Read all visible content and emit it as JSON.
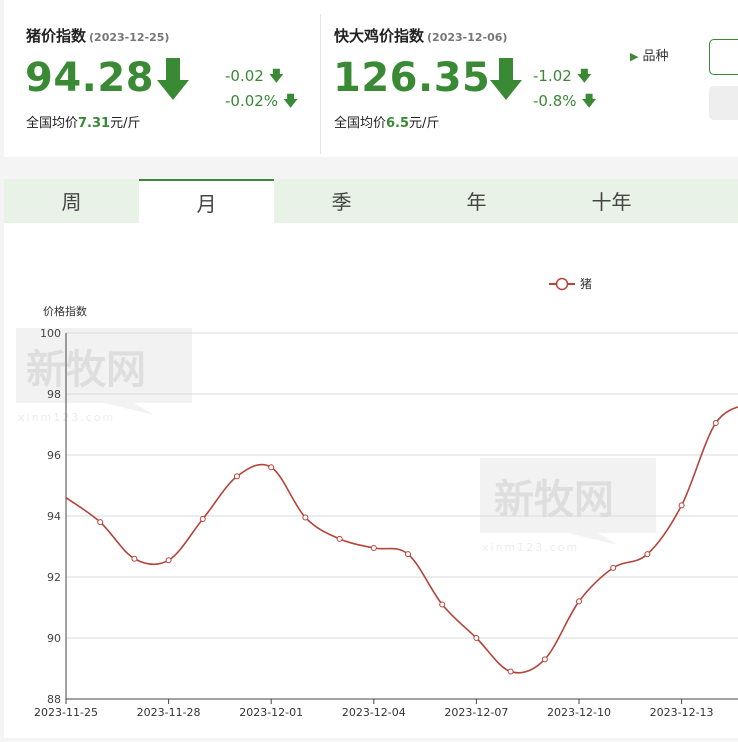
{
  "pig": {
    "title": "猪价指数",
    "date": "(2023-12-25)",
    "value": "94.28",
    "change": "-0.02",
    "change_pct": "-0.02%",
    "avg_prefix": "全国均价",
    "avg_value": "7.31",
    "avg_unit": "元/斤"
  },
  "chicken": {
    "title": "快大鸡价指数",
    "date": "(2023-12-06)",
    "value": "126.35",
    "change": "-1.02",
    "change_pct": "-0.8%",
    "avg_prefix": "全国均价",
    "avg_value": "6.5",
    "avg_unit": "元/斤"
  },
  "variety_label": "品种",
  "tabs": [
    "周",
    "月",
    "季",
    "年",
    "十年"
  ],
  "active_tab": 1,
  "colors": {
    "green": "#3a8a35",
    "line": "#b5433a"
  },
  "watermark": {
    "logo_text": "新牧网",
    "url_text": "xinm123.com"
  },
  "chart_data": {
    "type": "line",
    "ylabel": "价格指数",
    "ylim": [
      88,
      100
    ],
    "yticks": [
      88,
      90,
      92,
      94,
      96,
      98,
      100
    ],
    "xtick_labels": [
      "2023-11-25",
      "2023-11-28",
      "2023-12-01",
      "2023-12-04",
      "2023-12-07",
      "2023-12-10",
      "2023-12-13"
    ],
    "legend_position": "top-right",
    "grid": true,
    "series": [
      {
        "name": "猪",
        "x": [
          "2023-11-25",
          "2023-11-26",
          "2023-11-27",
          "2023-11-28",
          "2023-11-29",
          "2023-11-30",
          "2023-12-01",
          "2023-12-02",
          "2023-12-03",
          "2023-12-04",
          "2023-12-05",
          "2023-12-06",
          "2023-12-07",
          "2023-12-08",
          "2023-12-09",
          "2023-12-10",
          "2023-12-11",
          "2023-12-12",
          "2023-12-13",
          "2023-12-14",
          "2023-12-15"
        ],
        "values": [
          94.6,
          93.8,
          92.6,
          92.55,
          93.9,
          95.3,
          95.6,
          93.95,
          93.25,
          92.95,
          92.75,
          91.1,
          90.0,
          88.9,
          89.3,
          91.2,
          92.3,
          92.75,
          94.35,
          97.05,
          97.7
        ]
      }
    ]
  }
}
